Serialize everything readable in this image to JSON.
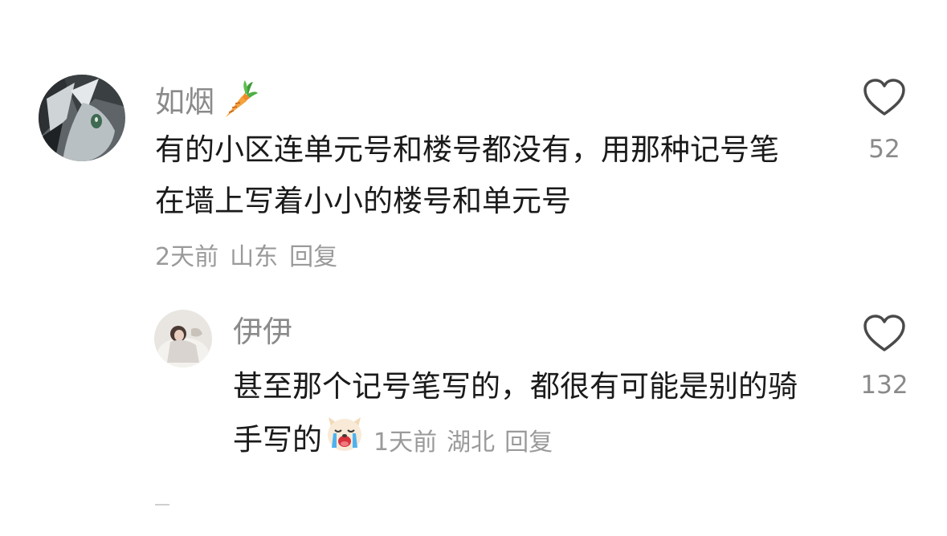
{
  "comments": [
    {
      "username": "如烟",
      "username_emoji": "carrot",
      "text": "有的小区连单元号和楼号都没有，用那种记号笔在墙上写着小小的楼号和单元号",
      "time": "2天前",
      "location": "山东",
      "reply_label": "回复",
      "like_count": "52",
      "like_icon": "heart-outline-icon"
    },
    {
      "username": "伊伊",
      "text": "甚至那个记号笔写的，都很有可能是别的骑手写的",
      "text_emoji": "crying-dog",
      "time": "1天前",
      "location": "湖北",
      "reply_label": "回复",
      "like_count": "132",
      "like_icon": "heart-outline-icon"
    }
  ],
  "colors": {
    "text_primary": "#1a1a1a",
    "text_secondary": "#8a8a8a",
    "heart_stroke": "#4a4a4a",
    "background": "#ffffff"
  }
}
